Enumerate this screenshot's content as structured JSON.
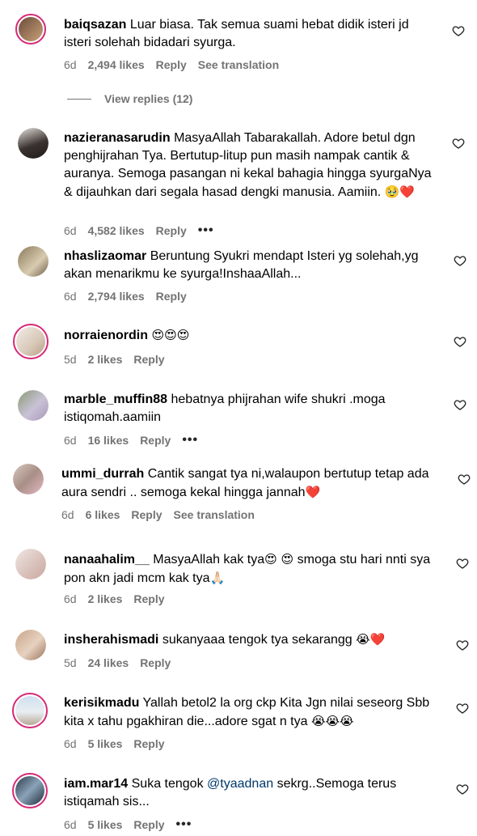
{
  "comments": [
    {
      "user": "baiqsazan",
      "text": "Luar biasa. Tak semua suami hebat didik isteri jd isteri solehah bidadari syurga.",
      "time": "6d",
      "likes": "2,494 likes",
      "reply": "Reply",
      "translate": "See translation"
    },
    {
      "user": "nazieranasarudin",
      "text": "MasyaAllah Tabarakallah. Adore betul dgn penghijrahan Tya. Bertutup-litup pun masih nampak cantik & auranya. Semoga pasangan ni kekal bahagia hingga syurgaNya & dijauhkan dari segala hasad dengki manusia. Aamiin.",
      "emoji": "🥹❤️",
      "time": "6d",
      "likes": "4,582 likes",
      "reply": "Reply"
    },
    {
      "user": "nhaslizaomar",
      "text": "Beruntung Syukri mendapt Isteri yg solehah,yg akan menarikmu ke syurga!InshaaAllah...",
      "time": "6d",
      "likes": "2,794 likes",
      "reply": "Reply"
    },
    {
      "user": "norraienordin",
      "emoji": "😍😍😍",
      "time": "5d",
      "likes": "2 likes",
      "reply": "Reply"
    },
    {
      "user": "marble_muffin88",
      "text": "hebatnya phijrahan wife shukri .moga istiqomah.aamiin",
      "time": "6d",
      "likes": "16 likes",
      "reply": "Reply"
    },
    {
      "user": "ummi_durrah",
      "text": "Cantik sangat tya ni,walaupon bertutup tetap ada aura sendri .. semoga kekal hingga jannah",
      "emoji": "❤️",
      "time": "6d",
      "likes": "6 likes",
      "reply": "Reply",
      "translate": "See translation"
    },
    {
      "user": "nanaahalim__",
      "text1": "MasyaAllah kak tya",
      "emoji1": "😍 😍",
      "text2": "smoga stu hari nnti sya pon akn jadi mcm kak tya",
      "emoji2": "🙏🏻",
      "time": "6d",
      "likes": "2 likes",
      "reply": "Reply"
    },
    {
      "user": "insherahismadi",
      "text": "sukanyaaa tengok tya sekarangg",
      "emoji": "😭❤️",
      "time": "5d",
      "likes": "24 likes",
      "reply": "Reply"
    },
    {
      "user": "kerisikmadu",
      "text": "Yallah betol2 la org ckp Kita Jgn nilai seseorg Sbb kita x tahu pgakhiran die...adore sgat n tya",
      "emoji": "😭😭😭",
      "time": "6d",
      "likes": "5 likes",
      "reply": "Reply"
    },
    {
      "user": "iam.mar14",
      "text1": "Suka tengok",
      "mention": "@tyaadnan",
      "text2": "sekrg..Semoga terus istiqamah sis...",
      "time": "6d",
      "likes": "5 likes",
      "reply": "Reply"
    }
  ],
  "view_replies": "View replies (12)",
  "more": "•••"
}
